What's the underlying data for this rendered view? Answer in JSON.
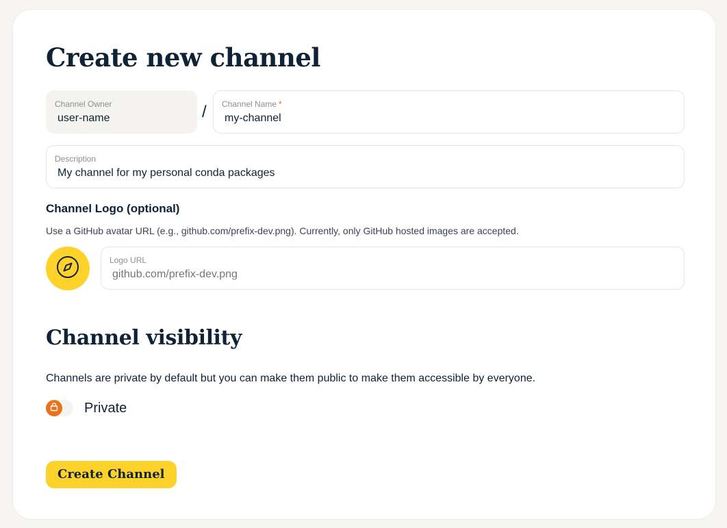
{
  "page": {
    "title": "Create new channel"
  },
  "owner_field": {
    "label": "Channel Owner",
    "value": "user-name"
  },
  "separator": "/",
  "name_field": {
    "label": "Channel Name",
    "required_marker": "*",
    "value": "my-channel"
  },
  "description_field": {
    "label": "Description",
    "value": "My channel for my personal conda packages"
  },
  "logo_section": {
    "title": "Channel Logo (optional)",
    "help": "Use a GitHub avatar URL (e.g., github.com/prefix-dev.png). Currently, only GitHub hosted images are accepted.",
    "placeholder_icon": "compass-icon",
    "url_field": {
      "label": "Logo URL",
      "placeholder": "github.com/prefix-dev.png",
      "value": ""
    }
  },
  "visibility": {
    "title": "Channel visibility",
    "description": "Channels are private by default but you can make them public to make them accessible by everyone.",
    "toggle_icon": "lock-icon",
    "toggle_label": "Private",
    "is_public": false
  },
  "submit": {
    "label": "Create Channel"
  },
  "colors": {
    "accent": "#fdd22a",
    "toggle_knob": "#e8731c",
    "required": "#e8663a",
    "text": "#0f2236",
    "background": "#f6f5f1"
  }
}
